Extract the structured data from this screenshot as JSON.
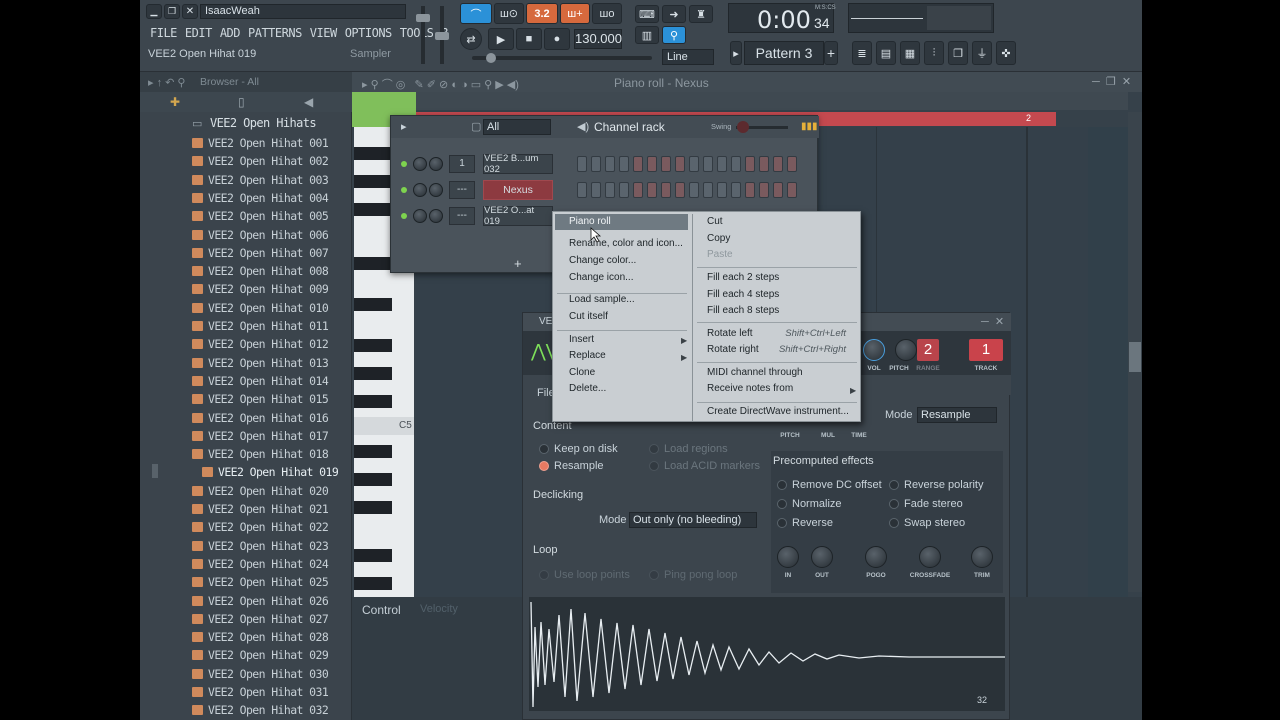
{
  "top": {
    "menu": [
      "FILE",
      "EDIT",
      "ADD",
      "PATTERNS",
      "VIEW",
      "OPTIONS",
      "TOOLS",
      "?"
    ],
    "username": "IsaacWeah",
    "hint_left": "VEE2 Open Hihat 019",
    "hint_right": "Sampler",
    "tempo": "130.000",
    "time": "0:00",
    "time_small": "34",
    "time_unit": "M:S:CS",
    "pattern": "Pattern 3",
    "snap": "Line",
    "mode_btns": [
      "3.2",
      "ш+",
      "шo"
    ]
  },
  "browser": {
    "title": "Browser - All",
    "folder": "VEE2 Open Hihats",
    "items": [
      "VEE2 Open Hihat 001",
      "VEE2 Open Hihat 002",
      "VEE2 Open Hihat 003",
      "VEE2 Open Hihat 004",
      "VEE2 Open Hihat 005",
      "VEE2 Open Hihat 006",
      "VEE2 Open Hihat 007",
      "VEE2 Open Hihat 008",
      "VEE2 Open Hihat 009",
      "VEE2 Open Hihat 010",
      "VEE2 Open Hihat 011",
      "VEE2 Open Hihat 012",
      "VEE2 Open Hihat 013",
      "VEE2 Open Hihat 014",
      "VEE2 Open Hihat 015",
      "VEE2 Open Hihat 016",
      "VEE2 Open Hihat 017",
      "VEE2 Open Hihat 018",
      "VEE2 Open Hihat 019",
      "VEE2 Open Hihat 020",
      "VEE2 Open Hihat 021",
      "VEE2 Open Hihat 022",
      "VEE2 Open Hihat 023",
      "VEE2 Open Hihat 024",
      "VEE2 Open Hihat 025",
      "VEE2 Open Hihat 026",
      "VEE2 Open Hihat 027",
      "VEE2 Open Hihat 028",
      "VEE2 Open Hihat 029",
      "VEE2 Open Hihat 030",
      "VEE2 Open Hihat 031",
      "VEE2 Open Hihat 032"
    ],
    "selected_index": 18
  },
  "piano_roll": {
    "title": "Piano roll - Nexus",
    "key_label": "C5",
    "bar_marker": "2",
    "control_label": "Control",
    "control_value": "Velocity"
  },
  "channel_rack": {
    "title": "Channel rack",
    "filter": "All",
    "swing_label": "Swing",
    "channels": [
      {
        "num": "1",
        "name": "VEE2 B...um 032"
      },
      {
        "num": "---",
        "name": "Nexus"
      },
      {
        "num": "---",
        "name": "VEE2 O...at 019"
      }
    ],
    "add": "+"
  },
  "context_menu": {
    "left": [
      {
        "label": "Piano roll",
        "highlight": true
      },
      {
        "label": "Rename, color and icon..."
      },
      {
        "label": "Change color..."
      },
      {
        "label": "Change icon..."
      },
      {
        "label": "Load sample..."
      },
      {
        "label": "Cut itself"
      },
      {
        "label": "Insert"
      },
      {
        "label": "Replace"
      },
      {
        "label": "Clone"
      },
      {
        "label": "Delete..."
      }
    ],
    "right": [
      {
        "label": "Cut"
      },
      {
        "label": "Copy"
      },
      {
        "label": "Paste",
        "disabled": true
      },
      {
        "label": "Fill each 2 steps"
      },
      {
        "label": "Fill each 4 steps"
      },
      {
        "label": "Fill each 8 steps"
      },
      {
        "label": "Rotate left",
        "shortcut": "Shift+Ctrl+Left"
      },
      {
        "label": "Rotate right",
        "shortcut": "Shift+Ctrl+Right"
      },
      {
        "label": "MIDI channel through"
      },
      {
        "label": "Receive notes from"
      },
      {
        "label": "Create DirectWave instrument..."
      }
    ]
  },
  "sampler": {
    "title_fragment": "VE",
    "file_label": "File",
    "vol": "VOL",
    "pitch": "PITCH",
    "range": "RANGE",
    "range_val": "2",
    "track": "TRACK",
    "track_val": "1",
    "knob_labels_top": [
      "PITCH",
      "MUL",
      "TIME"
    ],
    "mode_label": "Mode",
    "mode_value": "Resample",
    "content_title": "Content",
    "keep_on_disk": "Keep on disk",
    "resample": "Resample",
    "load_regions": "Load regions",
    "load_acid": "Load ACID markers",
    "precomputed_title": "Precomputed effects",
    "effects": [
      "Remove DC offset",
      "Reverse polarity",
      "Normalize",
      "Fade stereo",
      "Reverse",
      "Swap stereo"
    ],
    "declicking_title": "Declicking",
    "declick_mode_label": "Mode",
    "declick_mode_value": "Out only (no bleeding)",
    "loop_title": "Loop",
    "use_loop_points": "Use loop points",
    "ping_pong_loop": "Ping pong loop",
    "knob_labels_bottom": [
      "IN",
      "OUT",
      "POGO",
      "CROSSFADE",
      "TRIM"
    ],
    "waveform_value": "32"
  },
  "colors": {
    "accent_red": "#c04b52",
    "radio_on": "#e87a62",
    "header_blue": "#4a9bd6"
  }
}
